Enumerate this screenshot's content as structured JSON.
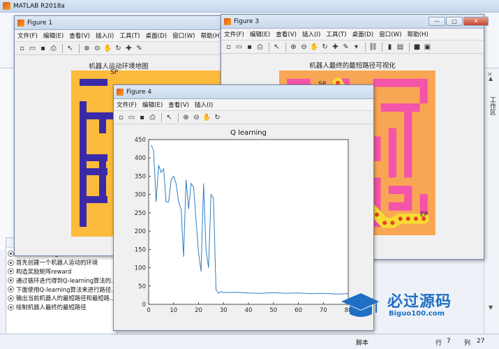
{
  "app": {
    "title": "MATLAB R2018a"
  },
  "right_rail": {
    "label": "工作区"
  },
  "history": {
    "items": [
      "基于Q-learning算法的机器人路径规...",
      "首先创建一个机器人运动的环境",
      "构造奖励矩阵reward",
      "通过循环迭代得到Q-learning算法的...",
      "下面使用Q-learning算法来进行路径...",
      "输出当前机器人的最短路径和最短路...",
      "绘制机器人最终的最短路径"
    ]
  },
  "status": {
    "script": "脚本",
    "row_label": "行",
    "row_value": "7",
    "col_label": "列",
    "col_value": "27"
  },
  "menus": [
    "文件(F)",
    "编辑(E)",
    "查看(V)",
    "插入(I)",
    "工具(T)",
    "桌面(D)",
    "窗口(W)",
    "帮助(H)"
  ],
  "menus_short": [
    "文件(F)",
    "编辑(E)",
    "查看(V)",
    "插入(I)"
  ],
  "figure1": {
    "title": "Figure 1",
    "plot_title": "机器人运动环境地图",
    "sp_label": "SP",
    "colors": {
      "bg": "#fcbb3c",
      "wall": "#3b2aa8"
    }
  },
  "figure3": {
    "title": "Figure 3",
    "plot_title": "机器人最终的最短路径可视化",
    "sp_label": "SP",
    "ep_label": "EP",
    "colors": {
      "bg": "#f9a654",
      "wall": "#f454a9",
      "path": "#f7dc32",
      "dot": "#e8402a"
    }
  },
  "figure4": {
    "title": "Figure 4",
    "plot_title": "Q learning"
  },
  "chart_data": {
    "type": "line",
    "title": "Q learning",
    "xlabel": "",
    "ylabel": "",
    "xlim": [
      0,
      80
    ],
    "ylim": [
      0,
      450
    ],
    "xticks": [
      0,
      10,
      20,
      30,
      40,
      50,
      60,
      70,
      80
    ],
    "yticks": [
      0,
      50,
      100,
      150,
      200,
      250,
      300,
      350,
      400,
      450
    ],
    "series": [
      {
        "color": "#2d7ec4",
        "x": [
          1,
          2,
          3,
          4,
          5,
          6,
          7,
          8,
          9,
          10,
          11,
          12,
          13,
          14,
          15,
          16,
          17,
          18,
          19,
          20,
          21,
          22,
          23,
          24,
          25,
          26,
          27,
          28,
          29,
          30,
          35,
          40,
          45,
          50,
          55,
          60,
          65,
          70,
          75,
          80
        ],
        "y": [
          435,
          420,
          280,
          380,
          360,
          370,
          280,
          280,
          340,
          350,
          330,
          280,
          260,
          130,
          340,
          260,
          330,
          320,
          230,
          140,
          90,
          330,
          150,
          100,
          300,
          290,
          40,
          30,
          35,
          32,
          33,
          31,
          30,
          32,
          30,
          31,
          29,
          30,
          28,
          29
        ]
      }
    ]
  },
  "watermark": {
    "text": "必过源码",
    "sub": "Biguo100.com"
  }
}
